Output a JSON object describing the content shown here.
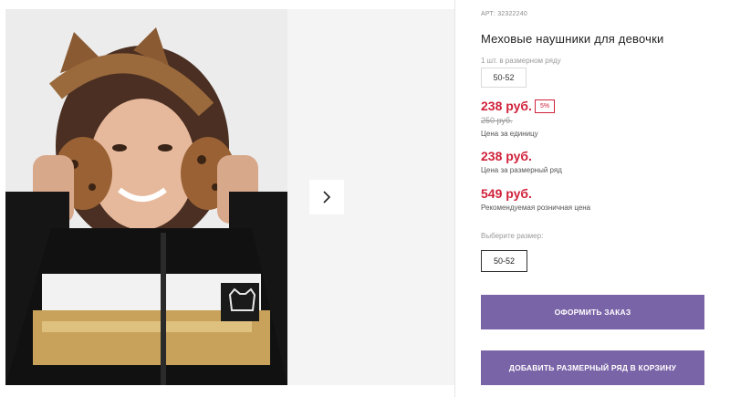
{
  "product": {
    "article": "АРТ: 32322240",
    "title": "Меховые наушники для девочки",
    "pack_label": "1 шт. в размерном ряду",
    "pack_size": "50-52",
    "price": "238 руб.",
    "discount": "5%",
    "old_price": "250 руб.",
    "unit_caption": "Цена за единицу",
    "pack_price": "238 руб.",
    "pack_caption": "Цена за размерный ряд",
    "retail_price": "549 руб.",
    "retail_caption": "Рекомендуемая розничная цена",
    "size_label": "Выберите размер:",
    "selected_size": "50-52"
  },
  "buttons": {
    "order": "Оформить заказ",
    "add_to_cart": "Добавить размерный ряд в корзину"
  },
  "gallery": {
    "next_icon": "chevron-right-icon"
  },
  "colors": {
    "price_red": "#d0223b",
    "button_purple": "#7a64a8"
  }
}
